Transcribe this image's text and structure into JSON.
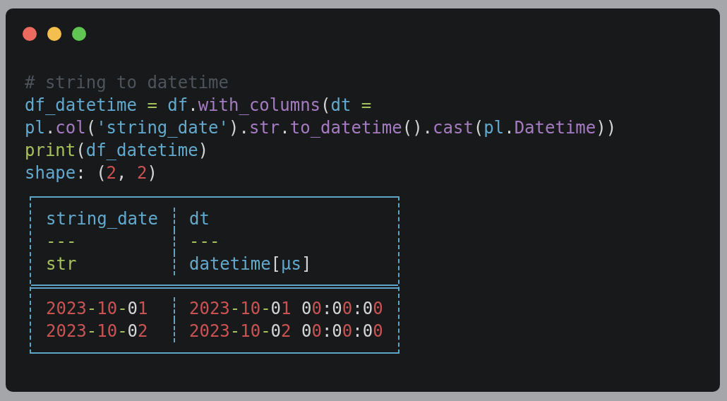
{
  "window": {
    "controls": [
      {
        "color": "#ed6a5e"
      },
      {
        "color": "#f5bf4f"
      },
      {
        "color": "#61c554"
      }
    ]
  },
  "code": {
    "lines": [
      [
        {
          "text": "# string to datetime",
          "kind": "comment"
        }
      ],
      [
        {
          "text": "df_datetime ",
          "kind": "id"
        },
        {
          "text": "=",
          "kind": "op"
        },
        {
          "text": " df",
          "kind": "id"
        },
        {
          "text": ".",
          "kind": "punc"
        },
        {
          "text": "with_columns",
          "kind": "fn"
        },
        {
          "text": "(",
          "kind": "punc"
        },
        {
          "text": "dt ",
          "kind": "id"
        },
        {
          "text": "=",
          "kind": "op"
        }
      ],
      [
        {
          "text": "pl",
          "kind": "id"
        },
        {
          "text": ".",
          "kind": "punc"
        },
        {
          "text": "col",
          "kind": "fn"
        },
        {
          "text": "(",
          "kind": "punc"
        },
        {
          "text": "'string_date'",
          "kind": "id"
        },
        {
          "text": ").",
          "kind": "punc"
        },
        {
          "text": "str",
          "kind": "fn"
        },
        {
          "text": ".",
          "kind": "punc"
        },
        {
          "text": "to_datetime",
          "kind": "fn"
        },
        {
          "text": "().",
          "kind": "punc"
        },
        {
          "text": "cast",
          "kind": "fn"
        },
        {
          "text": "(",
          "kind": "punc"
        },
        {
          "text": "pl",
          "kind": "id"
        },
        {
          "text": ".",
          "kind": "punc"
        },
        {
          "text": "Datetime",
          "kind": "fn"
        },
        {
          "text": "))",
          "kind": "punc"
        }
      ],
      [
        {
          "text": "print",
          "kind": "op"
        },
        {
          "text": "(",
          "kind": "punc"
        },
        {
          "text": "df_datetime",
          "kind": "id"
        },
        {
          "text": ")",
          "kind": "punc"
        }
      ],
      [
        {
          "text": "shape",
          "kind": "id"
        },
        {
          "text": ": (",
          "kind": "punc"
        },
        {
          "text": "2",
          "kind": "num"
        },
        {
          "text": ", ",
          "kind": "punc"
        },
        {
          "text": "2",
          "kind": "num"
        },
        {
          "text": ")",
          "kind": "punc"
        }
      ]
    ]
  },
  "table": {
    "header_rows": [
      [
        [
          {
            "text": "string_date",
            "kind": "id"
          }
        ],
        [
          {
            "text": "dt",
            "kind": "id"
          }
        ]
      ],
      [
        [
          {
            "text": "---",
            "kind": "op"
          }
        ],
        [
          {
            "text": "---",
            "kind": "op"
          }
        ]
      ],
      [
        [
          {
            "text": "str",
            "kind": "op"
          }
        ],
        [
          {
            "text": "datetime",
            "kind": "id"
          },
          {
            "text": "[",
            "kind": "punc"
          },
          {
            "text": "µs",
            "kind": "id"
          },
          {
            "text": "]",
            "kind": "punc"
          }
        ]
      ]
    ],
    "rows": [
      [
        [
          {
            "text": "2023",
            "kind": "num"
          },
          {
            "text": "-",
            "kind": "op"
          },
          {
            "text": "10",
            "kind": "num"
          },
          {
            "text": "-",
            "kind": "op"
          },
          {
            "text": "0",
            "kind": "punc"
          },
          {
            "text": "1",
            "kind": "num"
          }
        ],
        [
          {
            "text": "2023",
            "kind": "num"
          },
          {
            "text": "-",
            "kind": "op"
          },
          {
            "text": "10",
            "kind": "num"
          },
          {
            "text": "-",
            "kind": "op"
          },
          {
            "text": "0",
            "kind": "punc"
          },
          {
            "text": "1 ",
            "kind": "num"
          },
          {
            "text": "0",
            "kind": "punc"
          },
          {
            "text": "0",
            "kind": "num"
          },
          {
            "text": ":0",
            "kind": "punc"
          },
          {
            "text": "0",
            "kind": "num"
          },
          {
            "text": ":0",
            "kind": "punc"
          },
          {
            "text": "0",
            "kind": "num"
          }
        ]
      ],
      [
        [
          {
            "text": "2023",
            "kind": "num"
          },
          {
            "text": "-",
            "kind": "op"
          },
          {
            "text": "10",
            "kind": "num"
          },
          {
            "text": "-",
            "kind": "op"
          },
          {
            "text": "0",
            "kind": "punc"
          },
          {
            "text": "2",
            "kind": "num"
          }
        ],
        [
          {
            "text": "2023",
            "kind": "num"
          },
          {
            "text": "-",
            "kind": "op"
          },
          {
            "text": "10",
            "kind": "num"
          },
          {
            "text": "-",
            "kind": "op"
          },
          {
            "text": "0",
            "kind": "punc"
          },
          {
            "text": "2 ",
            "kind": "num"
          },
          {
            "text": "0",
            "kind": "punc"
          },
          {
            "text": "0",
            "kind": "num"
          },
          {
            "text": ":0",
            "kind": "punc"
          },
          {
            "text": "0",
            "kind": "num"
          },
          {
            "text": ":0",
            "kind": "punc"
          },
          {
            "text": "0",
            "kind": "num"
          }
        ]
      ]
    ]
  }
}
